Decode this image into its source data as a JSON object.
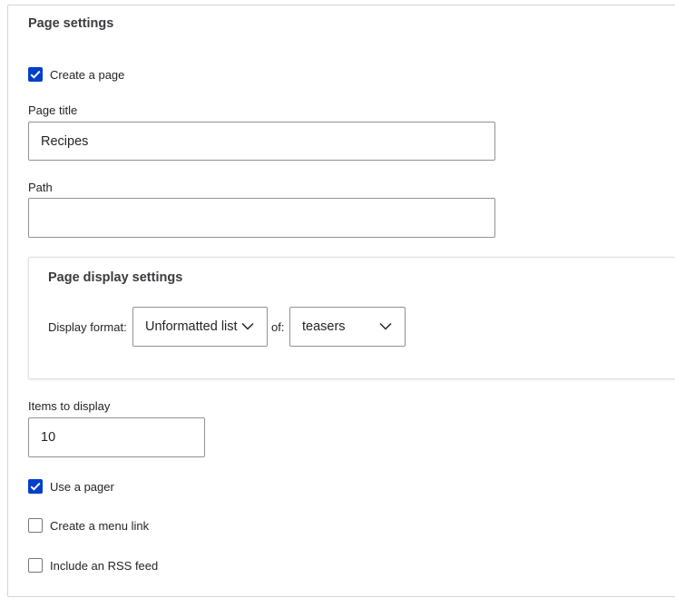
{
  "page_settings": {
    "legend": "Page settings",
    "create_page": {
      "label": "Create a page",
      "checked": true
    },
    "page_title": {
      "label": "Page title",
      "value": "Recipes"
    },
    "path": {
      "label": "Path",
      "value": ""
    },
    "display_settings": {
      "legend": "Page display settings",
      "format_label": "Display format:",
      "format_value": "Unformatted list",
      "of_label": "of:",
      "of_value": "teasers"
    },
    "items_to_display": {
      "label": "Items to display",
      "value": "10"
    },
    "use_pager": {
      "label": "Use a pager",
      "checked": true
    },
    "menu_link": {
      "label": "Create a menu link",
      "checked": false
    },
    "rss_feed": {
      "label": "Include an RSS feed",
      "checked": false
    }
  },
  "colors": {
    "accent": "#003ecc",
    "border": "#919297",
    "text": "#232429"
  }
}
